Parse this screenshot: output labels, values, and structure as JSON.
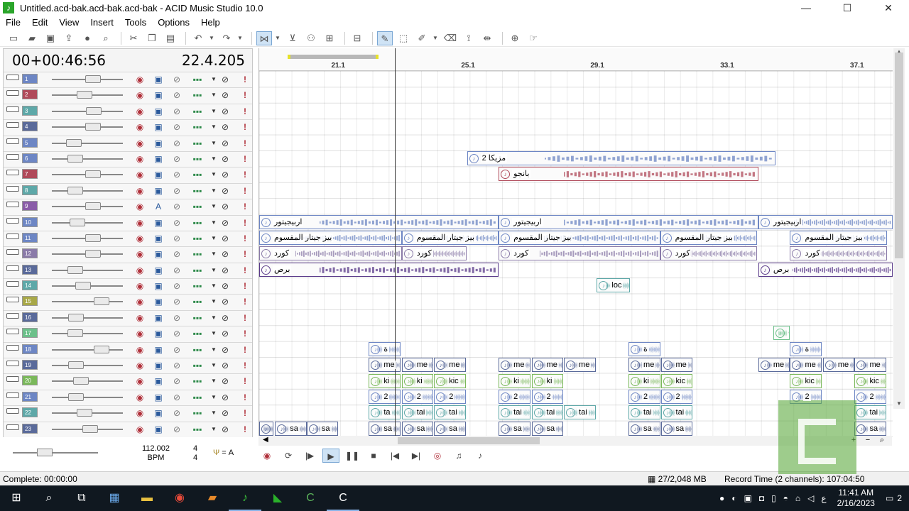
{
  "window": {
    "title": "Untitled.acd-bak.acd-bak.acd-bak - ACID Music Studio 10.0",
    "controls": [
      "—",
      "☐",
      "✕"
    ]
  },
  "menu": [
    "File",
    "Edit",
    "View",
    "Insert",
    "Tools",
    "Options",
    "Help"
  ],
  "toolbar_icons": [
    "new-file-icon",
    "open-folder-icon",
    "save-icon",
    "publish-icon",
    "properties-icon",
    "explore-icon",
    "cut-icon",
    "copy-icon",
    "paste-icon",
    "undo-icon",
    "redo-icon",
    "snap-icon",
    "draw-tool-icon",
    "select-tool-icon",
    "paint-tool-icon",
    "erase-tool-icon",
    "envelope-tool-icon",
    "split-icon"
  ],
  "time_display": {
    "time": "00+00:46:56",
    "measure": "22.4.205"
  },
  "tracks": [
    {
      "num": "1",
      "color": "#6d86c4",
      "fader": 0.6
    },
    {
      "num": "2",
      "color": "#b04a5a",
      "fader": 0.45
    },
    {
      "num": "3",
      "color": "#5ea8a8",
      "fader": 0.62
    },
    {
      "num": "4",
      "color": "#5a6a9a",
      "fader": 0.6
    },
    {
      "num": "5",
      "color": "#6d86c4",
      "fader": 0.25
    },
    {
      "num": "6",
      "color": "#6d86c4",
      "fader": 0.28
    },
    {
      "num": "7",
      "color": "#b04a5a",
      "fader": 0.6
    },
    {
      "num": "8",
      "color": "#5ea8a8",
      "fader": 0.28
    },
    {
      "num": "9",
      "color": "#8a5ca8",
      "fader": 0.6,
      "auto": true
    },
    {
      "num": "10",
      "color": "#6d86c4",
      "fader": 0.32
    },
    {
      "num": "11",
      "color": "#6d86c4",
      "fader": 0.6
    },
    {
      "num": "12",
      "color": "#8a7aa8",
      "fader": 0.6
    },
    {
      "num": "13",
      "color": "#5a6a9a",
      "fader": 0.28
    },
    {
      "num": "14",
      "color": "#5ea8a8",
      "fader": 0.42
    },
    {
      "num": "15",
      "color": "#a8a848",
      "fader": 0.75
    },
    {
      "num": "16",
      "color": "#5a6a9a",
      "fader": 0.3
    },
    {
      "num": "17",
      "color": "#6cc08a",
      "fader": 0.28
    },
    {
      "num": "18",
      "color": "#6d86c4",
      "fader": 0.75
    },
    {
      "num": "19",
      "color": "#5a6a9a",
      "fader": 0.3
    },
    {
      "num": "20",
      "color": "#7ab85a",
      "fader": 0.38
    },
    {
      "num": "21",
      "color": "#6d86c4",
      "fader": 0.3
    },
    {
      "num": "22",
      "color": "#5ea8a8",
      "fader": 0.45
    },
    {
      "num": "23",
      "color": "#5a6a9a",
      "fader": 0.55
    }
  ],
  "ruler": [
    {
      "label": "21.1",
      "pos": 0.125
    },
    {
      "label": "25.1",
      "pos": 0.33
    },
    {
      "label": "29.1",
      "pos": 0.534
    },
    {
      "label": "33.1",
      "pos": 0.739
    },
    {
      "label": "37.1",
      "pos": 0.944
    }
  ],
  "clips": [
    {
      "track": 6,
      "start": 0.328,
      "width": 0.487,
      "label": "مزيكا 2",
      "color": "#6d86c4"
    },
    {
      "track": 7,
      "start": 0.378,
      "width": 0.41,
      "label": "بانجو",
      "color": "#b04a5a"
    },
    {
      "track": 10,
      "start": 0.0,
      "width": 0.378,
      "label": "اربيجيتور",
      "color": "#6d86c4"
    },
    {
      "track": 10,
      "start": 0.378,
      "width": 0.41,
      "label": "اربيجيتور",
      "color": "#6d86c4"
    },
    {
      "track": 10,
      "start": 0.788,
      "width": 0.212,
      "label": "اربيجيتور",
      "color": "#6d86c4"
    },
    {
      "track": 11,
      "start": 0.0,
      "width": 0.225,
      "label": "بيز جيتار المقسوم",
      "color": "#6d86c4"
    },
    {
      "track": 11,
      "start": 0.225,
      "width": 0.153,
      "label": "بيز جيتار المقسوم",
      "color": "#6d86c4"
    },
    {
      "track": 11,
      "start": 0.378,
      "width": 0.255,
      "label": "بيز جيتار المقسوم",
      "color": "#6d86c4"
    },
    {
      "track": 11,
      "start": 0.633,
      "width": 0.153,
      "label": "بيز جيتار المقسوم",
      "color": "#6d86c4"
    },
    {
      "track": 11,
      "start": 0.838,
      "width": 0.153,
      "label": "بيز جيتار المقسوم",
      "color": "#6d86c4"
    },
    {
      "track": 12,
      "start": 0.0,
      "width": 0.225,
      "label": "كورد",
      "color": "#8a7aa8"
    },
    {
      "track": 12,
      "start": 0.225,
      "width": 0.102,
      "label": "كورد",
      "color": "#8a7aa8"
    },
    {
      "track": 12,
      "start": 0.378,
      "width": 0.255,
      "label": "كورد",
      "color": "#8a7aa8"
    },
    {
      "track": 12,
      "start": 0.633,
      "width": 0.153,
      "label": "كورد",
      "color": "#8a7aa8"
    },
    {
      "track": 12,
      "start": 0.838,
      "width": 0.153,
      "label": "كورد",
      "color": "#8a7aa8"
    },
    {
      "track": 13,
      "start": 0.0,
      "width": 0.378,
      "label": "برص",
      "color": "#5a3a8a"
    },
    {
      "track": 13,
      "start": 0.788,
      "width": 0.212,
      "label": "برص",
      "color": "#5a3a8a"
    },
    {
      "track": 14,
      "start": 0.533,
      "width": 0.052,
      "label": "loc",
      "color": "#5ea8a8"
    },
    {
      "track": 17,
      "start": 0.812,
      "width": 0.026,
      "label": "Cc",
      "color": "#6cc08a"
    },
    {
      "track": 18,
      "start": 0.173,
      "width": 0.05,
      "label": "ة",
      "color": "#6d86c4"
    },
    {
      "track": 18,
      "start": 0.583,
      "width": 0.05,
      "label": "ة",
      "color": "#6d86c4"
    },
    {
      "track": 18,
      "start": 0.838,
      "width": 0.05,
      "label": "ة",
      "color": "#6d86c4"
    },
    {
      "track": 19,
      "start": 0.173,
      "width": 0.05,
      "label": "me",
      "color": "#5a6a9a"
    },
    {
      "track": 19,
      "start": 0.225,
      "width": 0.05,
      "label": "me",
      "color": "#5a6a9a"
    },
    {
      "track": 19,
      "start": 0.276,
      "width": 0.05,
      "label": "me",
      "color": "#5a6a9a"
    },
    {
      "track": 19,
      "start": 0.378,
      "width": 0.05,
      "label": "me",
      "color": "#5a6a9a"
    },
    {
      "track": 19,
      "start": 0.43,
      "width": 0.05,
      "label": "me",
      "color": "#5a6a9a"
    },
    {
      "track": 19,
      "start": 0.481,
      "width": 0.05,
      "label": "me",
      "color": "#5a6a9a"
    },
    {
      "track": 19,
      "start": 0.583,
      "width": 0.05,
      "label": "me",
      "color": "#5a6a9a"
    },
    {
      "track": 19,
      "start": 0.634,
      "width": 0.05,
      "label": "me",
      "color": "#5a6a9a"
    },
    {
      "track": 19,
      "start": 0.788,
      "width": 0.05,
      "label": "me",
      "color": "#5a6a9a"
    },
    {
      "track": 19,
      "start": 0.838,
      "width": 0.05,
      "label": "me",
      "color": "#5a6a9a"
    },
    {
      "track": 19,
      "start": 0.89,
      "width": 0.05,
      "label": "me",
      "color": "#5a6a9a"
    },
    {
      "track": 19,
      "start": 0.94,
      "width": 0.05,
      "label": "me",
      "color": "#5a6a9a"
    },
    {
      "track": 20,
      "start": 0.173,
      "width": 0.05,
      "label": "ki",
      "color": "#7ab85a"
    },
    {
      "track": 20,
      "start": 0.225,
      "width": 0.05,
      "label": "ki",
      "color": "#7ab85a"
    },
    {
      "track": 20,
      "start": 0.276,
      "width": 0.05,
      "label": "kic",
      "color": "#7ab85a"
    },
    {
      "track": 20,
      "start": 0.378,
      "width": 0.05,
      "label": "ki",
      "color": "#7ab85a"
    },
    {
      "track": 20,
      "start": 0.43,
      "width": 0.05,
      "label": "ki",
      "color": "#7ab85a"
    },
    {
      "track": 20,
      "start": 0.583,
      "width": 0.05,
      "label": "ki",
      "color": "#7ab85a"
    },
    {
      "track": 20,
      "start": 0.634,
      "width": 0.05,
      "label": "kic",
      "color": "#7ab85a"
    },
    {
      "track": 20,
      "start": 0.838,
      "width": 0.05,
      "label": "kic",
      "color": "#7ab85a"
    },
    {
      "track": 20,
      "start": 0.94,
      "width": 0.05,
      "label": "kic",
      "color": "#7ab85a"
    },
    {
      "track": 21,
      "start": 0.173,
      "width": 0.05,
      "label": "2",
      "color": "#6d86c4"
    },
    {
      "track": 21,
      "start": 0.225,
      "width": 0.05,
      "label": "2",
      "color": "#6d86c4"
    },
    {
      "track": 21,
      "start": 0.276,
      "width": 0.05,
      "label": "2",
      "color": "#6d86c4"
    },
    {
      "track": 21,
      "start": 0.378,
      "width": 0.05,
      "label": "2",
      "color": "#6d86c4"
    },
    {
      "track": 21,
      "start": 0.43,
      "width": 0.05,
      "label": "2",
      "color": "#6d86c4"
    },
    {
      "track": 21,
      "start": 0.583,
      "width": 0.05,
      "label": "2",
      "color": "#6d86c4"
    },
    {
      "track": 21,
      "start": 0.634,
      "width": 0.05,
      "label": "2",
      "color": "#6d86c4"
    },
    {
      "track": 21,
      "start": 0.838,
      "width": 0.05,
      "label": "2",
      "color": "#6d86c4"
    },
    {
      "track": 21,
      "start": 0.94,
      "width": 0.05,
      "label": "2",
      "color": "#6d86c4"
    },
    {
      "track": 22,
      "start": 0.173,
      "width": 0.05,
      "label": "ta",
      "color": "#5ea8a8"
    },
    {
      "track": 22,
      "start": 0.225,
      "width": 0.05,
      "label": "tai",
      "color": "#5ea8a8"
    },
    {
      "track": 22,
      "start": 0.276,
      "width": 0.05,
      "label": "tai",
      "color": "#5ea8a8"
    },
    {
      "track": 22,
      "start": 0.378,
      "width": 0.05,
      "label": "tai",
      "color": "#5ea8a8"
    },
    {
      "track": 22,
      "start": 0.43,
      "width": 0.05,
      "label": "tai",
      "color": "#5ea8a8"
    },
    {
      "track": 22,
      "start": 0.481,
      "width": 0.05,
      "label": "tai",
      "color": "#5ea8a8"
    },
    {
      "track": 22,
      "start": 0.583,
      "width": 0.05,
      "label": "tai",
      "color": "#5ea8a8"
    },
    {
      "track": 22,
      "start": 0.634,
      "width": 0.05,
      "label": "tai",
      "color": "#5ea8a8"
    },
    {
      "track": 22,
      "start": 0.94,
      "width": 0.05,
      "label": "tai",
      "color": "#5ea8a8"
    },
    {
      "track": 23,
      "start": 0.0,
      "width": 0.02,
      "label": "sa",
      "color": "#5a6a9a"
    },
    {
      "track": 23,
      "start": 0.025,
      "width": 0.05,
      "label": "sa",
      "color": "#5a6a9a"
    },
    {
      "track": 23,
      "start": 0.075,
      "width": 0.05,
      "label": "sa",
      "color": "#5a6a9a"
    },
    {
      "track": 23,
      "start": 0.173,
      "width": 0.05,
      "label": "sa",
      "color": "#5a6a9a"
    },
    {
      "track": 23,
      "start": 0.225,
      "width": 0.05,
      "label": "sa",
      "color": "#5a6a9a"
    },
    {
      "track": 23,
      "start": 0.276,
      "width": 0.05,
      "label": "sa",
      "color": "#5a6a9a"
    },
    {
      "track": 23,
      "start": 0.378,
      "width": 0.05,
      "label": "sa",
      "color": "#5a6a9a"
    },
    {
      "track": 23,
      "start": 0.43,
      "width": 0.05,
      "label": "sa",
      "color": "#5a6a9a"
    },
    {
      "track": 23,
      "start": 0.583,
      "width": 0.05,
      "label": "sa",
      "color": "#5a6a9a"
    },
    {
      "track": 23,
      "start": 0.634,
      "width": 0.05,
      "label": "sa",
      "color": "#5a6a9a"
    },
    {
      "track": 23,
      "start": 0.94,
      "width": 0.05,
      "label": "sa",
      "color": "#5a6a9a"
    }
  ],
  "cursor_pos": 0.214,
  "transport": {
    "buttons": [
      "record-icon",
      "loop-icon",
      "play-from-start-icon",
      "play-icon",
      "pause-icon",
      "stop-icon",
      "go-to-start-icon",
      "go-to-end-icon",
      "metronome-icon",
      "tuner-icon"
    ]
  },
  "master": {
    "fader": 0.35
  },
  "tempo": {
    "bpm": "112.002",
    "bpm_label": "BPM",
    "meter_top": "4",
    "meter_bottom": "4",
    "key": "= A"
  },
  "status": {
    "left": "Complete: 00:00:00",
    "memory": "27/2,048 MB",
    "record_time": "Record Time (2 channels): 107:04:50"
  },
  "taskbar": {
    "time": "11:41 AM",
    "date": "2/16/2023",
    "language": "ع",
    "notifications": "2"
  }
}
